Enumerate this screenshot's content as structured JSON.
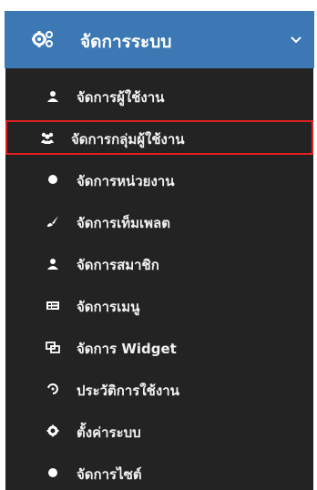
{
  "header": {
    "icon": "cogs-icon",
    "label": "จัดการระบบ",
    "chevron": "chevron-down-icon"
  },
  "colors": {
    "header_bg": "#3c78b4",
    "list_bg": "#232323",
    "highlight": "#e02020",
    "text": "#f2f2f2"
  },
  "items": [
    {
      "label": "จัดการผู้ใช้งาน",
      "icon": "user-icon"
    },
    {
      "label": "จัดการกลุ่มผู้ใช้งาน",
      "icon": "users-group-icon",
      "highlighted": true
    },
    {
      "label": "จัดการหน่วยงาน",
      "icon": "circle-icon"
    },
    {
      "label": "จัดการเท็มเพลต",
      "icon": "brush-icon"
    },
    {
      "label": "จัดการสมาชิก",
      "icon": "user-icon"
    },
    {
      "label": "จัดการเมนู",
      "icon": "list-card-icon"
    },
    {
      "label": "จัดการ Widget",
      "icon": "widget-icon"
    },
    {
      "label": "ประวัติการใช้งาน",
      "icon": "history-icon"
    },
    {
      "label": "ตั้งค่าระบบ",
      "icon": "gear-icon"
    },
    {
      "label": "จัดการไซต์",
      "icon": "circle-icon"
    }
  ]
}
